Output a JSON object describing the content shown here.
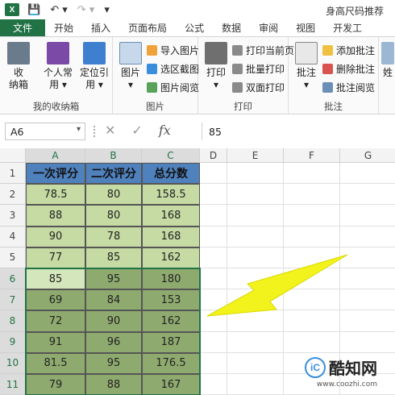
{
  "title_bar": {
    "app_icon": "X",
    "doc_title": "身高尺码推荐"
  },
  "tabs": [
    "文件",
    "开始",
    "插入",
    "页面布局",
    "公式",
    "数据",
    "审阅",
    "视图",
    "开发工"
  ],
  "ribbon": {
    "g1": {
      "big1": "收\n纳箱",
      "big2": "个人常\n用 ▾",
      "big3": "定位引\n用 ▾",
      "label": "我的收纳箱"
    },
    "g2": {
      "big": "图片\n▾",
      "items": [
        "导入图片",
        "选区截图",
        "图片阅览"
      ],
      "label": "图片"
    },
    "g3": {
      "big": "打印\n▾",
      "items": [
        "打印当前页",
        "批量打印",
        "双面打印"
      ],
      "label": "打印"
    },
    "g4": {
      "big": "批注\n▾",
      "items": [
        "添加批注",
        "删除批注",
        "批注阅览"
      ],
      "label": "批注"
    },
    "g5": {
      "big": "姓"
    }
  },
  "formula_bar": {
    "name_box": "A6",
    "name_dd": "▾",
    "fx": "fx",
    "value": "85"
  },
  "columns": [
    "A",
    "B",
    "C",
    "D",
    "E",
    "F",
    "G"
  ],
  "rows": [
    "1",
    "2",
    "3",
    "4",
    "5",
    "6",
    "7",
    "8",
    "9",
    "10",
    "11"
  ],
  "table": {
    "headers": [
      "一次评分",
      "二次评分",
      "总分数"
    ],
    "data": [
      [
        "78.5",
        "80",
        "158.5"
      ],
      [
        "88",
        "80",
        "168"
      ],
      [
        "90",
        "78",
        "168"
      ],
      [
        "77",
        "85",
        "162"
      ],
      [
        "85",
        "95",
        "180"
      ],
      [
        "69",
        "84",
        "153"
      ],
      [
        "72",
        "90",
        "162"
      ],
      [
        "91",
        "96",
        "187"
      ],
      [
        "81.5",
        "95",
        "176.5"
      ],
      [
        "79",
        "88",
        "167"
      ]
    ]
  },
  "colors": {
    "excel_green": "#217346",
    "header_blue": "#4f81bd",
    "light_green": "#c5dba3",
    "dark_green": "#8faa6f",
    "arrow_yellow": "#f2f21c"
  },
  "watermark": {
    "logo": "iC",
    "text": "酷知网",
    "url": "www.coozhi.com"
  }
}
